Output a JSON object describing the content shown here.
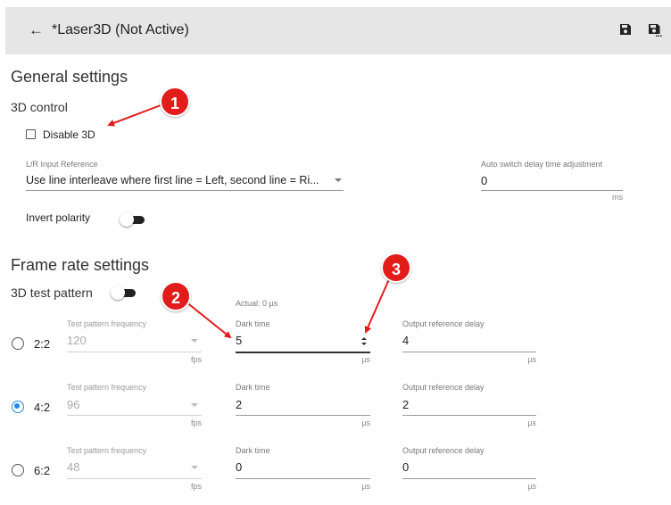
{
  "header": {
    "back_icon": "arrow-left-icon",
    "title": "*Laser3D (Not Active)",
    "save_icon": "save-icon",
    "save_as_icon": "save-as-icon"
  },
  "general": {
    "title": "General settings",
    "control_title": "3D control",
    "disable_label": "Disable 3D",
    "disable_checked": false,
    "lr_label": "L/R Input Reference",
    "lr_value": "Use line interleave where first line = Left, second line = Ri...",
    "auto_label": "Auto switch delay time adjustment",
    "auto_value": "0",
    "auto_unit": "ms",
    "invert_label": "Invert polarity",
    "invert_on": false
  },
  "frame": {
    "title": "Frame rate settings",
    "test_pattern_label": "3D test pattern",
    "test_pattern_on": false,
    "actual": "Actual: 0 µs",
    "rows": [
      {
        "ratio": "2:2",
        "selected": false,
        "freq_label": "Test pattern frequency",
        "freq": "120",
        "freq_unit": "fps",
        "dark_label": "Dark time",
        "dark": "5",
        "dark_unit": "µs",
        "out_label": "Output reference delay",
        "out": "4",
        "out_unit": "µs"
      },
      {
        "ratio": "4:2",
        "selected": true,
        "freq_label": "Test pattern frequency",
        "freq": "96",
        "freq_unit": "fps",
        "dark_label": "Dark time",
        "dark": "2",
        "dark_unit": "µs",
        "out_label": "Output reference delay",
        "out": "2",
        "out_unit": "µs"
      },
      {
        "ratio": "6:2",
        "selected": false,
        "freq_label": "Test pattern frequency",
        "freq": "48",
        "freq_unit": "fps",
        "dark_label": "Dark time",
        "dark": "0",
        "dark_unit": "µs",
        "out_label": "Output reference delay",
        "out": "0",
        "out_unit": "µs"
      }
    ]
  },
  "callouts": [
    "1",
    "2",
    "3"
  ],
  "colors": {
    "accent": "#1e88e5",
    "callout": "#e21b1b",
    "header_bg": "#e6e6e6"
  }
}
